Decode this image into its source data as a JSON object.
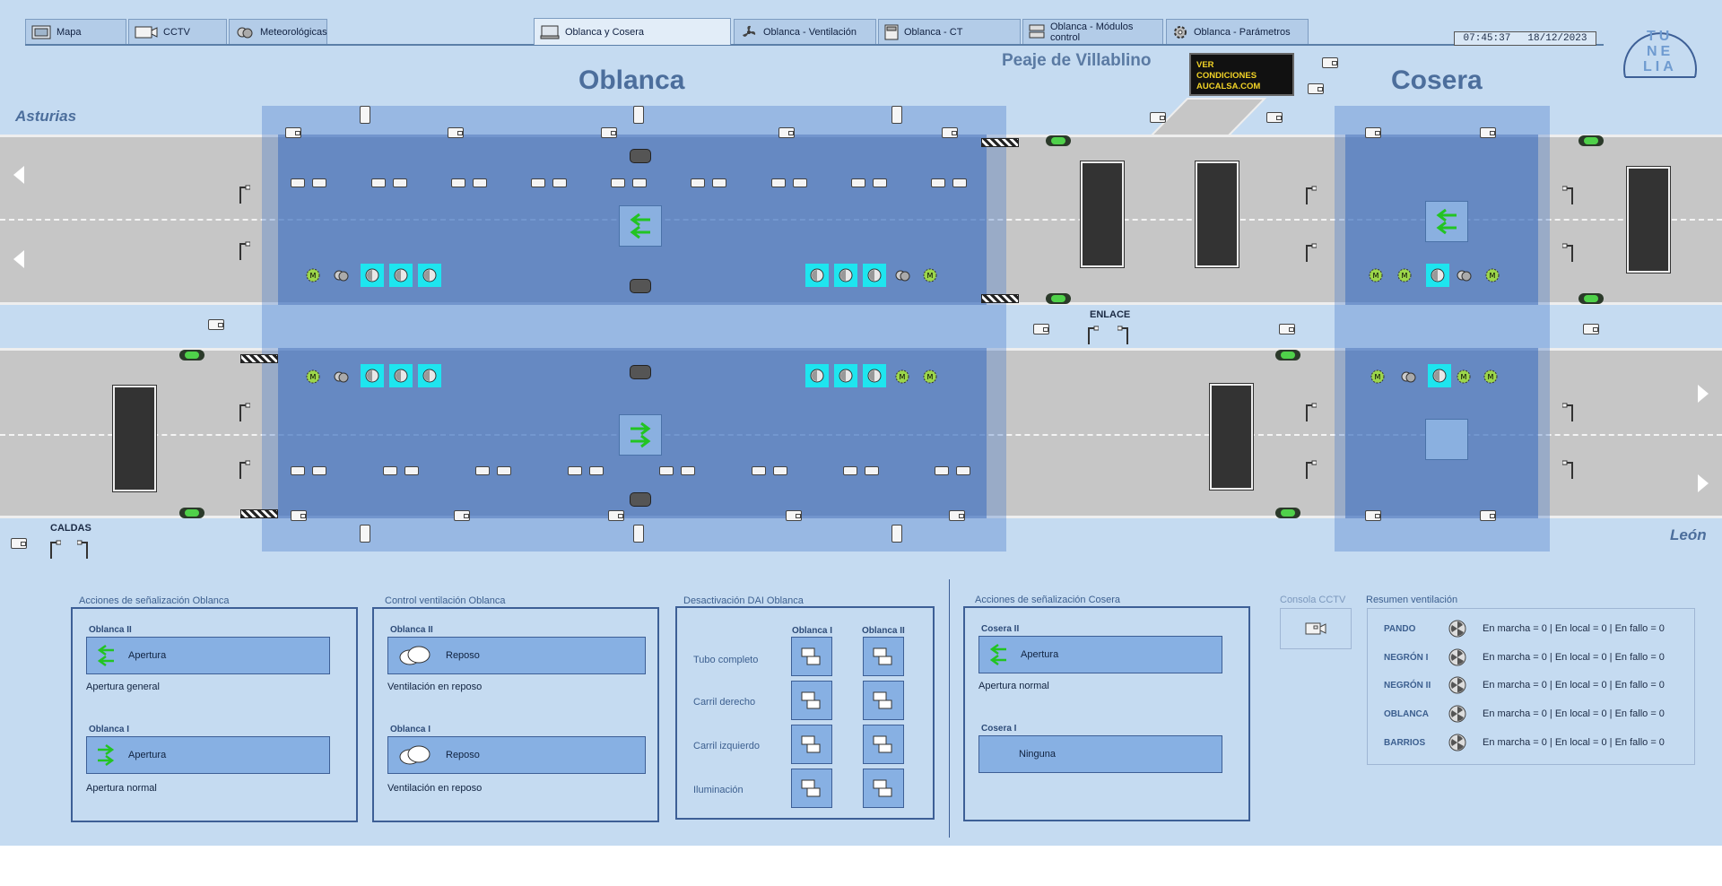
{
  "tabs": [
    {
      "label": "Mapa",
      "icon": "map-icon"
    },
    {
      "label": "CCTV",
      "icon": "camera-icon"
    },
    {
      "label": "Meteorológicas",
      "icon": "weather-icon"
    },
    {
      "label": "Oblanca y Cosera",
      "icon": "monitor-icon",
      "active": true
    },
    {
      "label": "Oblanca - Ventilación",
      "icon": "fan-icon"
    },
    {
      "label": "Oblanca - CT",
      "icon": "calculator-icon"
    },
    {
      "label": "Oblanca - Módulos control",
      "icon": "server-icon"
    },
    {
      "label": "Oblanca - Parámetros",
      "icon": "gear-icon"
    }
  ],
  "clock": {
    "time": "07:45:37",
    "date": "18/12/2023"
  },
  "logo": {
    "letters": [
      "TU",
      "NE",
      "LIA"
    ]
  },
  "map": {
    "tunnel_oblanca": "Oblanca",
    "tunnel_cosera": "Cosera",
    "peaje": "Peaje de Villablino",
    "vms_text": [
      "VER",
      "CONDICIONES",
      "AUCALSA.COM"
    ],
    "direction_north": "Asturias",
    "direction_south": "León",
    "enlace": "ENLACE",
    "caldas": "CALDAS",
    "colors": {
      "tunnel_zone": "#3c6ebe",
      "signal_green": "#4fd14a",
      "dai_active": "#1ee5ef"
    }
  },
  "oblanca_signaling": {
    "title": "Acciones de señalización Oblanca",
    "tube2": {
      "name": "Oblanca II",
      "action": "Apertura",
      "note": "Apertura general"
    },
    "tube1": {
      "name": "Oblanca I",
      "action": "Apertura",
      "note": "Apertura normal"
    }
  },
  "oblanca_ventilation": {
    "title": "Control ventilación Oblanca",
    "tube2": {
      "name": "Oblanca II",
      "action": "Reposo",
      "note": "Ventilación en reposo"
    },
    "tube1": {
      "name": "Oblanca I",
      "action": "Reposo",
      "note": "Ventilación en reposo"
    }
  },
  "dai": {
    "title": "Desactivación DAI Oblanca",
    "columns": [
      "Oblanca I",
      "Oblanca II"
    ],
    "rows": [
      "Tubo completo",
      "Carril derecho",
      "Carril izquierdo",
      "Iluminación"
    ]
  },
  "cosera_signaling": {
    "title": "Acciones de señalización Cosera",
    "tube2": {
      "name": "Cosera II",
      "action": "Apertura",
      "note": "Apertura normal"
    },
    "tube1": {
      "name": "Cosera I",
      "action": "Ninguna"
    }
  },
  "cctv_console": {
    "title": "Consola CCTV"
  },
  "vent_summary": {
    "title": "Resumen ventilación",
    "rows": [
      {
        "name": "PANDO",
        "status": "En marcha = 0 | En local = 0 | En fallo = 0"
      },
      {
        "name": "NEGRÓN I",
        "status": "En marcha = 0 | En local = 0 | En fallo = 0"
      },
      {
        "name": "NEGRÓN II",
        "status": "En marcha = 0 | En local = 0 | En fallo = 0"
      },
      {
        "name": "OBLANCA",
        "status": "En marcha = 0 | En local = 0 | En fallo = 0"
      },
      {
        "name": "BARRIOS",
        "status": "En marcha = 0 | En local = 0 | En fallo = 0"
      }
    ]
  }
}
